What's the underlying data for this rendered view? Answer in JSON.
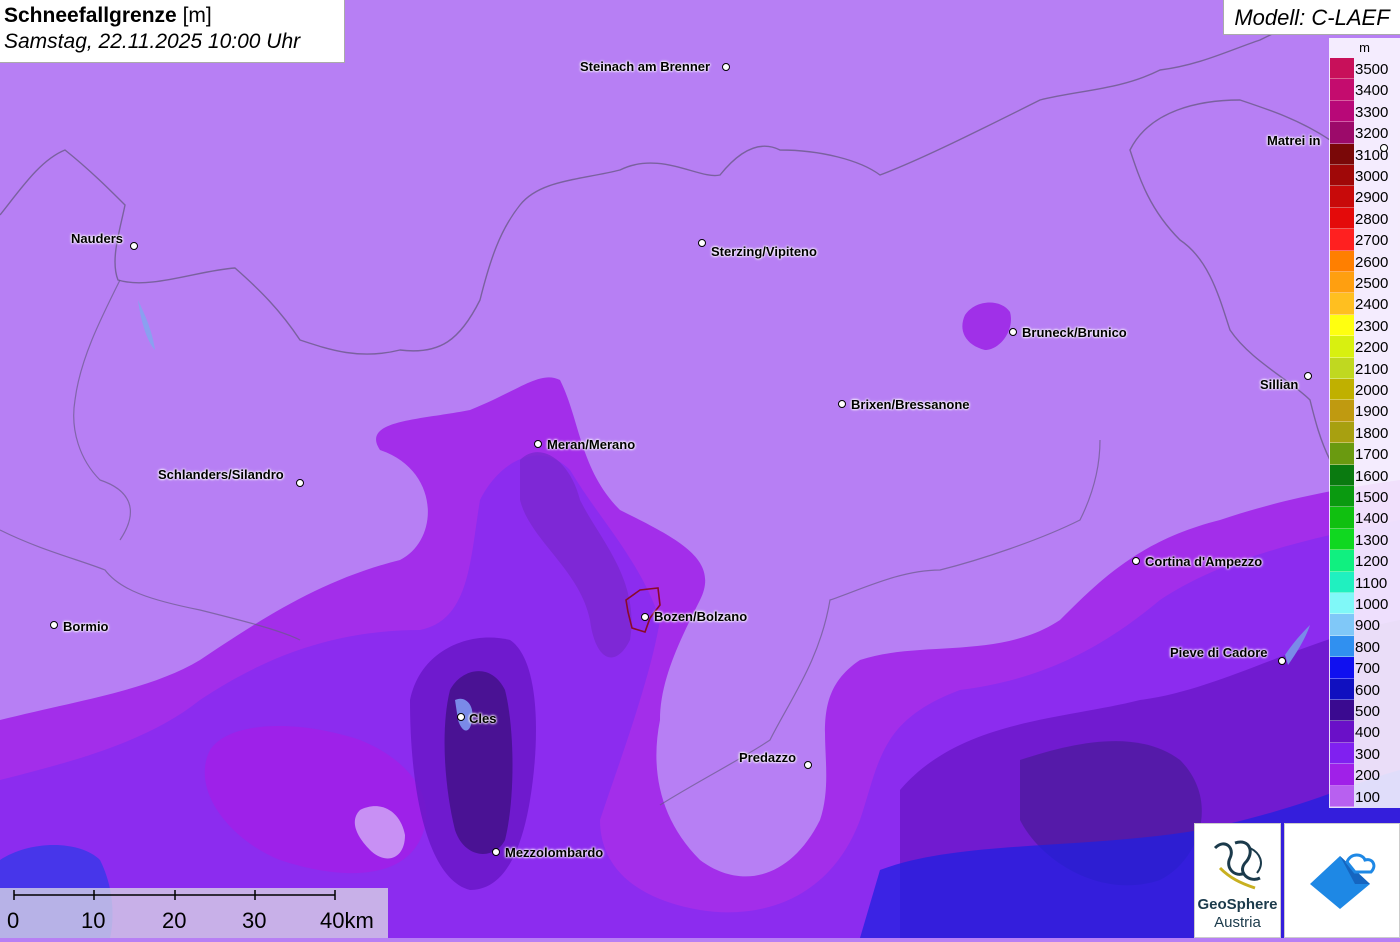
{
  "title": {
    "main": "Schneefallgrenze",
    "unit": "[m]",
    "date": "Samstag, 22.11.2025 10:00 Uhr"
  },
  "model": "Modell: C-LAEF",
  "legend": {
    "unit": "m",
    "entries": [
      {
        "label": "3500",
        "color": "#c8105a"
      },
      {
        "label": "3400",
        "color": "#c40c6e"
      },
      {
        "label": "3300",
        "color": "#b80878"
      },
      {
        "label": "3200",
        "color": "#9c0a6a"
      },
      {
        "label": "3100",
        "color": "#7a0808"
      },
      {
        "label": "3000",
        "color": "#a00808"
      },
      {
        "label": "2900",
        "color": "#c80a0a"
      },
      {
        "label": "2800",
        "color": "#e40a0a"
      },
      {
        "label": "2700",
        "color": "#ff2020"
      },
      {
        "label": "2600",
        "color": "#ff7f00"
      },
      {
        "label": "2500",
        "color": "#ff9f10"
      },
      {
        "label": "2400",
        "color": "#ffbf20"
      },
      {
        "label": "2300",
        "color": "#ffff10"
      },
      {
        "label": "2200",
        "color": "#d8f010"
      },
      {
        "label": "2100",
        "color": "#c0d820"
      },
      {
        "label": "2000",
        "color": "#c0b000"
      },
      {
        "label": "1900",
        "color": "#c09a10"
      },
      {
        "label": "1800",
        "color": "#a8a010"
      },
      {
        "label": "1700",
        "color": "#6a9a10"
      },
      {
        "label": "1600",
        "color": "#0a7a10"
      },
      {
        "label": "1500",
        "color": "#0a9a10"
      },
      {
        "label": "1400",
        "color": "#10c010"
      },
      {
        "label": "1300",
        "color": "#10d820"
      },
      {
        "label": "1200",
        "color": "#10f080"
      },
      {
        "label": "1100",
        "color": "#20f0c0"
      },
      {
        "label": "1000",
        "color": "#80f8f8"
      },
      {
        "label": "900",
        "color": "#80c8f8"
      },
      {
        "label": "800",
        "color": "#3090f0"
      },
      {
        "label": "700",
        "color": "#1010f0"
      },
      {
        "label": "600",
        "color": "#1010c0"
      },
      {
        "label": "500",
        "color": "#3a0a90"
      },
      {
        "label": "400",
        "color": "#6a10c8"
      },
      {
        "label": "300",
        "color": "#8020f0"
      },
      {
        "label": "200",
        "color": "#a020e8"
      },
      {
        "label": "100",
        "color": "#b860f0"
      }
    ]
  },
  "towns": [
    {
      "name": "Steinach am Brenner"
    },
    {
      "name": "Matrei in"
    },
    {
      "name": "Nauders"
    },
    {
      "name": "Sterzing/Vipiteno"
    },
    {
      "name": "Bruneck/Brunico"
    },
    {
      "name": "Sillian"
    },
    {
      "name": "Brixen/Bressanone"
    },
    {
      "name": "Meran/Merano"
    },
    {
      "name": "Schlanders/Silandro"
    },
    {
      "name": "Cortina d'Ampezzo"
    },
    {
      "name": "Bormio"
    },
    {
      "name": "Bozen/Bolzano"
    },
    {
      "name": "Pieve di Cadore"
    },
    {
      "name": "Cles"
    },
    {
      "name": "Predazzo"
    },
    {
      "name": "Mezzolombardo"
    }
  ],
  "scale": {
    "ticks": [
      "0",
      "10",
      "20",
      "30",
      "40km"
    ]
  },
  "logos": {
    "geosphere_line1": "GeoSphere",
    "geosphere_line2": "Austria"
  },
  "colors": {
    "base": "#b77ff4",
    "level_100": "#b860f0",
    "level_200": "#a020e8",
    "level_300": "#8020f0",
    "level_400": "#6a10c8",
    "level_500": "#3a0a90",
    "level_700": "#1010f0"
  }
}
